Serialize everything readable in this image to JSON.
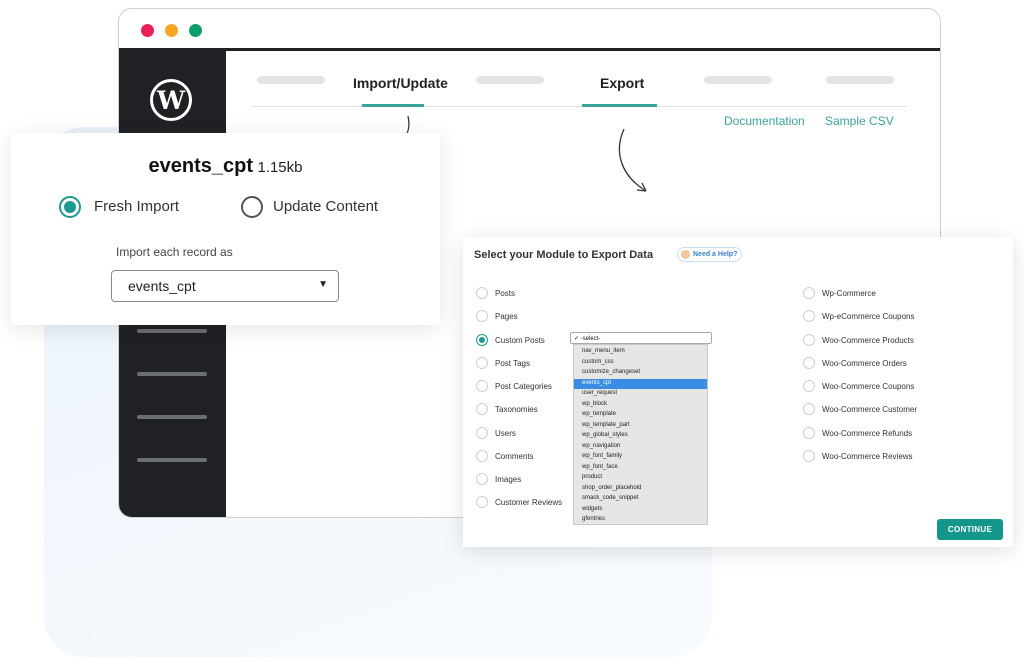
{
  "colors": {
    "accent": "#1d9a90",
    "sidebar": "#1f2124",
    "link": "#3aa39a"
  },
  "window": {
    "controls": [
      "close",
      "minimize",
      "maximize"
    ]
  },
  "tabs": {
    "import_update": "Import/Update",
    "export": "Export"
  },
  "links": {
    "documentation": "Documentation",
    "sample_csv": "Sample CSV"
  },
  "import_card": {
    "file_name": "events_cpt",
    "file_size": "1.15kb",
    "option_fresh": "Fresh Import",
    "option_update": "Update Content",
    "selected_option": "Fresh Import",
    "record_label": "Import each record as",
    "record_value": "events_cpt"
  },
  "export_panel": {
    "title": "Select your Module to Export Data",
    "help": "Need a Help?",
    "left_modules": [
      "Posts",
      "Pages",
      "Custom Posts",
      "Post Tags",
      "Post Categories",
      "Taxonomies",
      "Users",
      "Comments",
      "Images",
      "Customer Reviews"
    ],
    "right_modules": [
      "Wp-Commerce",
      "Wp-eCommerce Coupons",
      "Woo-Commerce Products",
      "Woo-Commerce Orders",
      "Woo-Commerce Coupons",
      "Woo-Commerce Customer",
      "Woo-Commerce Refunds",
      "Woo-Commerce Reviews"
    ],
    "selected_module": "Custom Posts",
    "select_placeholder": "✓ -select-",
    "dropdown_options": [
      "nav_menu_item",
      "custom_css",
      "customize_changeset",
      "events_cpt",
      "user_request",
      "wp_block",
      "wp_template",
      "wp_template_part",
      "wp_global_styles",
      "wp_navigation",
      "wp_font_family",
      "wp_font_face",
      "product",
      "shop_order_placehold",
      "smack_code_snippet",
      "widgets",
      "gfentries"
    ],
    "highlighted_option": "events_cpt",
    "continue": "CONTINUE"
  }
}
